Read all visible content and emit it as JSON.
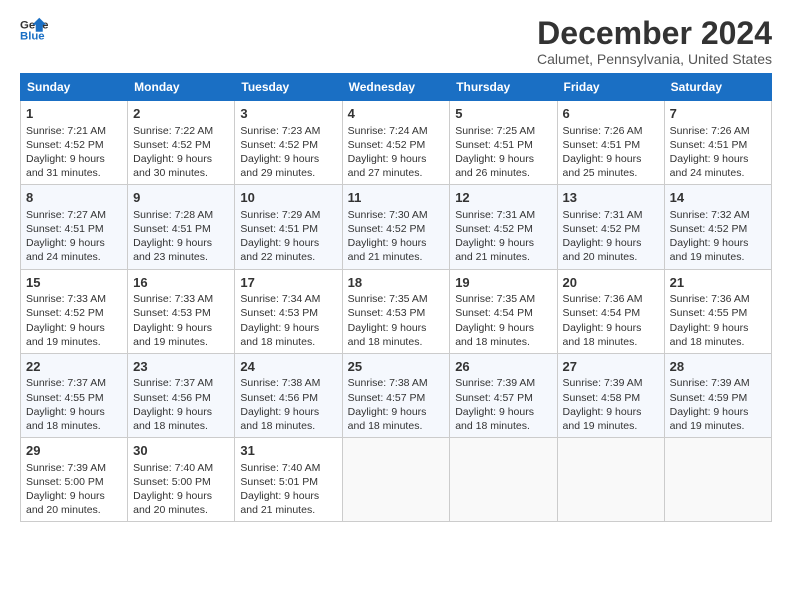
{
  "header": {
    "logo_line1": "General",
    "logo_line2": "Blue",
    "month": "December 2024",
    "location": "Calumet, Pennsylvania, United States"
  },
  "weekdays": [
    "Sunday",
    "Monday",
    "Tuesday",
    "Wednesday",
    "Thursday",
    "Friday",
    "Saturday"
  ],
  "weeks": [
    [
      {
        "day": "1",
        "info": "Sunrise: 7:21 AM\nSunset: 4:52 PM\nDaylight: 9 hours and 31 minutes."
      },
      {
        "day": "2",
        "info": "Sunrise: 7:22 AM\nSunset: 4:52 PM\nDaylight: 9 hours and 30 minutes."
      },
      {
        "day": "3",
        "info": "Sunrise: 7:23 AM\nSunset: 4:52 PM\nDaylight: 9 hours and 29 minutes."
      },
      {
        "day": "4",
        "info": "Sunrise: 7:24 AM\nSunset: 4:52 PM\nDaylight: 9 hours and 27 minutes."
      },
      {
        "day": "5",
        "info": "Sunrise: 7:25 AM\nSunset: 4:51 PM\nDaylight: 9 hours and 26 minutes."
      },
      {
        "day": "6",
        "info": "Sunrise: 7:26 AM\nSunset: 4:51 PM\nDaylight: 9 hours and 25 minutes."
      },
      {
        "day": "7",
        "info": "Sunrise: 7:26 AM\nSunset: 4:51 PM\nDaylight: 9 hours and 24 minutes."
      }
    ],
    [
      {
        "day": "8",
        "info": "Sunrise: 7:27 AM\nSunset: 4:51 PM\nDaylight: 9 hours and 24 minutes."
      },
      {
        "day": "9",
        "info": "Sunrise: 7:28 AM\nSunset: 4:51 PM\nDaylight: 9 hours and 23 minutes."
      },
      {
        "day": "10",
        "info": "Sunrise: 7:29 AM\nSunset: 4:51 PM\nDaylight: 9 hours and 22 minutes."
      },
      {
        "day": "11",
        "info": "Sunrise: 7:30 AM\nSunset: 4:52 PM\nDaylight: 9 hours and 21 minutes."
      },
      {
        "day": "12",
        "info": "Sunrise: 7:31 AM\nSunset: 4:52 PM\nDaylight: 9 hours and 21 minutes."
      },
      {
        "day": "13",
        "info": "Sunrise: 7:31 AM\nSunset: 4:52 PM\nDaylight: 9 hours and 20 minutes."
      },
      {
        "day": "14",
        "info": "Sunrise: 7:32 AM\nSunset: 4:52 PM\nDaylight: 9 hours and 19 minutes."
      }
    ],
    [
      {
        "day": "15",
        "info": "Sunrise: 7:33 AM\nSunset: 4:52 PM\nDaylight: 9 hours and 19 minutes."
      },
      {
        "day": "16",
        "info": "Sunrise: 7:33 AM\nSunset: 4:53 PM\nDaylight: 9 hours and 19 minutes."
      },
      {
        "day": "17",
        "info": "Sunrise: 7:34 AM\nSunset: 4:53 PM\nDaylight: 9 hours and 18 minutes."
      },
      {
        "day": "18",
        "info": "Sunrise: 7:35 AM\nSunset: 4:53 PM\nDaylight: 9 hours and 18 minutes."
      },
      {
        "day": "19",
        "info": "Sunrise: 7:35 AM\nSunset: 4:54 PM\nDaylight: 9 hours and 18 minutes."
      },
      {
        "day": "20",
        "info": "Sunrise: 7:36 AM\nSunset: 4:54 PM\nDaylight: 9 hours and 18 minutes."
      },
      {
        "day": "21",
        "info": "Sunrise: 7:36 AM\nSunset: 4:55 PM\nDaylight: 9 hours and 18 minutes."
      }
    ],
    [
      {
        "day": "22",
        "info": "Sunrise: 7:37 AM\nSunset: 4:55 PM\nDaylight: 9 hours and 18 minutes."
      },
      {
        "day": "23",
        "info": "Sunrise: 7:37 AM\nSunset: 4:56 PM\nDaylight: 9 hours and 18 minutes."
      },
      {
        "day": "24",
        "info": "Sunrise: 7:38 AM\nSunset: 4:56 PM\nDaylight: 9 hours and 18 minutes."
      },
      {
        "day": "25",
        "info": "Sunrise: 7:38 AM\nSunset: 4:57 PM\nDaylight: 9 hours and 18 minutes."
      },
      {
        "day": "26",
        "info": "Sunrise: 7:39 AM\nSunset: 4:57 PM\nDaylight: 9 hours and 18 minutes."
      },
      {
        "day": "27",
        "info": "Sunrise: 7:39 AM\nSunset: 4:58 PM\nDaylight: 9 hours and 19 minutes."
      },
      {
        "day": "28",
        "info": "Sunrise: 7:39 AM\nSunset: 4:59 PM\nDaylight: 9 hours and 19 minutes."
      }
    ],
    [
      {
        "day": "29",
        "info": "Sunrise: 7:39 AM\nSunset: 5:00 PM\nDaylight: 9 hours and 20 minutes."
      },
      {
        "day": "30",
        "info": "Sunrise: 7:40 AM\nSunset: 5:00 PM\nDaylight: 9 hours and 20 minutes."
      },
      {
        "day": "31",
        "info": "Sunrise: 7:40 AM\nSunset: 5:01 PM\nDaylight: 9 hours and 21 minutes."
      },
      {
        "day": "",
        "info": ""
      },
      {
        "day": "",
        "info": ""
      },
      {
        "day": "",
        "info": ""
      },
      {
        "day": "",
        "info": ""
      }
    ]
  ]
}
